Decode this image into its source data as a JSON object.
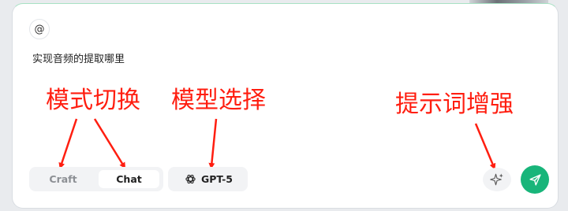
{
  "composer": {
    "mention_symbol": "@",
    "input_text": "实现音频的提取哪里"
  },
  "annotations": {
    "mode_switch": "模式切换",
    "model_select": "模型选择",
    "prompt_enhance": "提示词增强"
  },
  "mode_toggle": {
    "options": [
      "Craft",
      "Chat"
    ],
    "selected": "Chat"
  },
  "model_selector": {
    "label": "GPT-5",
    "icon": "openai-icon"
  },
  "actions": {
    "enhance_icon": "sparkle-icon",
    "send_icon": "send-icon"
  },
  "colors": {
    "annotation": "#ff1e10",
    "send_button": "#18b57a",
    "card_top_border": "#a8e2c4"
  }
}
